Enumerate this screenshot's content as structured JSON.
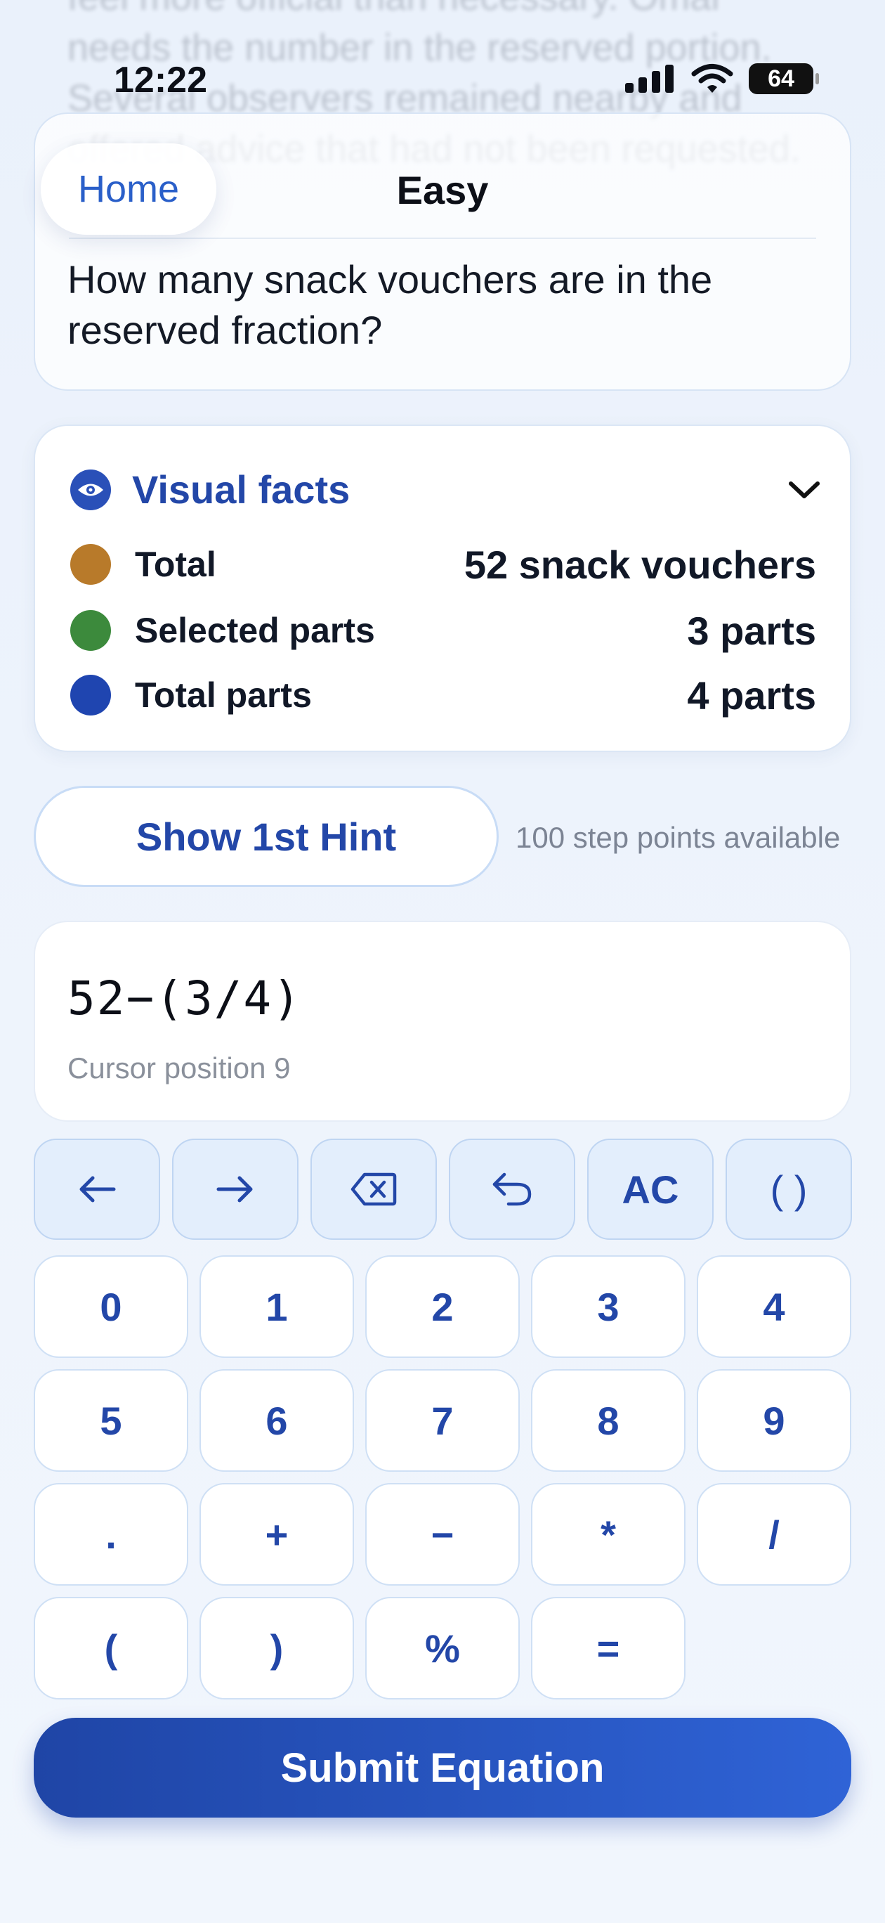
{
  "status": {
    "time": "12:22",
    "battery": "64"
  },
  "background_passage": "feel more official than necessary. Omar needs the number in the reserved portion. Several observers remained nearby and offered advice that had not been requested.",
  "nav": {
    "home": "Home",
    "title": "Easy"
  },
  "question": "How many snack vouchers are in the reserved fraction?",
  "visual_facts": {
    "title": "Visual facts",
    "items": [
      {
        "label": "Total",
        "value": "52 snack vouchers",
        "color": "#b87a2a"
      },
      {
        "label": "Selected parts",
        "value": "3 parts",
        "color": "#3c8a3c"
      },
      {
        "label": "Total parts",
        "value": "4 parts",
        "color": "#1f45b0"
      }
    ]
  },
  "hint": {
    "button": "Show 1st Hint",
    "info": "100 step points available"
  },
  "equation": {
    "value": "52−(3/4)",
    "cursor": "Cursor position 9"
  },
  "keypad": {
    "function_keys": [
      {
        "name": "cursor-left-button",
        "icon": "arrow-left-icon",
        "label": ""
      },
      {
        "name": "cursor-right-button",
        "icon": "arrow-right-icon",
        "label": ""
      },
      {
        "name": "backspace-button",
        "icon": "backspace-icon",
        "label": ""
      },
      {
        "name": "undo-button",
        "icon": "undo-icon",
        "label": ""
      },
      {
        "name": "clear-button",
        "icon": "",
        "label": "AC"
      },
      {
        "name": "parentheses-button",
        "icon": "",
        "label": "( )"
      }
    ],
    "rows": [
      [
        "0",
        "1",
        "2",
        "3",
        "4"
      ],
      [
        "5",
        "6",
        "7",
        "8",
        "9"
      ],
      [
        ".",
        "+",
        "−",
        "*",
        "/"
      ],
      [
        "(",
        ")",
        "%",
        "="
      ]
    ]
  },
  "submit": "Submit Equation",
  "colors": {
    "accent": "#2347a8",
    "submit_start": "#1f45a6",
    "submit_end": "#2f63d6"
  }
}
